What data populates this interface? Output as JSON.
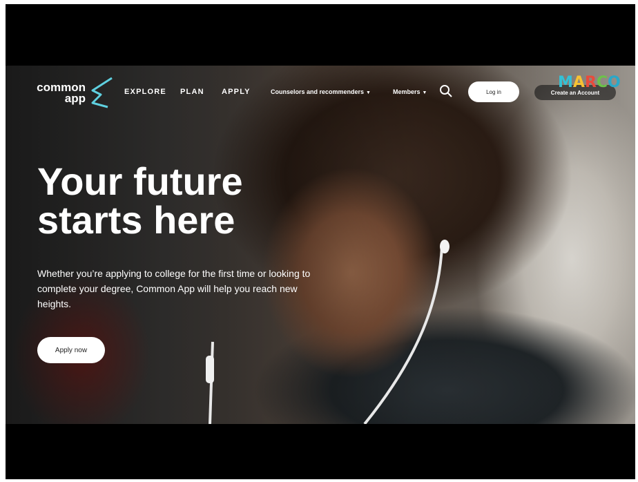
{
  "logo": {
    "line1": "common",
    "line2": "app"
  },
  "nav": {
    "explore": "EXPLORE",
    "plan": "PLAN",
    "apply": "APPLY",
    "counselors": "Counselors and recommenders",
    "members": "Members",
    "login": "Log in",
    "create_account": "Create an Account"
  },
  "watermark": {
    "letters": [
      "M",
      "A",
      "R",
      "C",
      "O"
    ]
  },
  "hero": {
    "title_line1": "Your future",
    "title_line2": "starts here",
    "body": "Whether you’re applying to college for the first time or looking to complete your degree, Common App will help you reach new heights.",
    "cta": "Apply now"
  },
  "colors": {
    "logo_accent": "#5fd0e0",
    "marco_m": "#33c1d6",
    "marco_a": "#f7c233",
    "marco_r": "#e84b3c",
    "marco_c": "#6cc24a",
    "marco_o": "#2aa8c9"
  },
  "icons": {
    "search": "search-icon",
    "caret": "chevron-down-icon"
  }
}
